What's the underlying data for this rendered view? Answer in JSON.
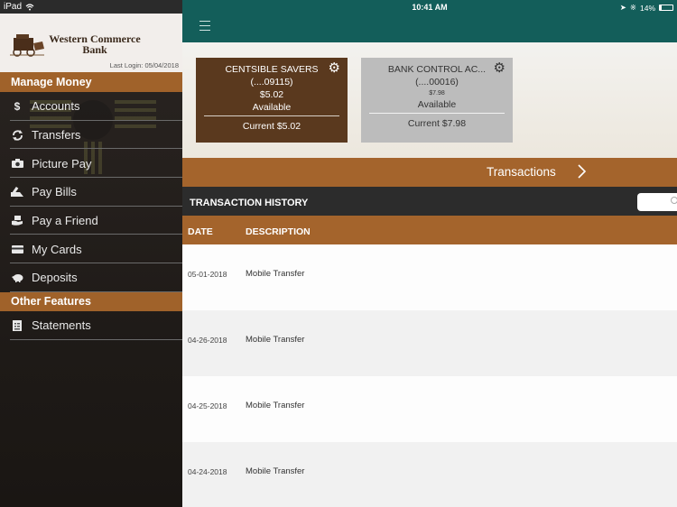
{
  "status_bar": {
    "device": "iPad",
    "time": "10:41 AM",
    "battery": "14%"
  },
  "sidebar": {
    "bank_name_line1": "Western Commerce",
    "bank_name_line2": "Bank",
    "last_login": "Last Login:  05/04/2018",
    "sections": [
      {
        "title": "Manage Money",
        "items": [
          {
            "label": "Accounts",
            "icon": "dollar-icon"
          },
          {
            "label": "Transfers",
            "icon": "refresh-icon"
          },
          {
            "label": "Picture Pay",
            "icon": "camera-icon"
          },
          {
            "label": "Pay Bills",
            "icon": "pay-bills-icon"
          },
          {
            "label": "Pay a Friend",
            "icon": "hand-money-icon"
          },
          {
            "label": "My Cards",
            "icon": "credit-card-icon"
          },
          {
            "label": "Deposits",
            "icon": "piggy-bank-icon"
          }
        ]
      },
      {
        "title": "Other Features",
        "items": [
          {
            "label": "Statements",
            "icon": "document-icon"
          }
        ]
      }
    ]
  },
  "accounts": [
    {
      "name": "CENTSIBLE SAVERS",
      "number": "(....09115)",
      "available_amount": "$5.02",
      "available_label": "Available",
      "current": "Current $5.02",
      "selected": true
    },
    {
      "name": "BANK CONTROL AC...",
      "number": "(....00016)",
      "available_amount": "$7.98",
      "available_label": "Available",
      "current": "Current $7.98",
      "selected": false
    }
  ],
  "transactions_bar": {
    "label": "Transactions"
  },
  "history": {
    "title": "TRANSACTION HISTORY",
    "search_placeholder": "",
    "columns": [
      "DATE",
      "DESCRIPTION"
    ],
    "rows": [
      {
        "date": "05-01-2018",
        "description": "Mobile Transfer"
      },
      {
        "date": "04-26-2018",
        "description": "Mobile Transfer"
      },
      {
        "date": "04-25-2018",
        "description": "Mobile Transfer"
      },
      {
        "date": "04-24-2018",
        "description": "Mobile Transfer"
      }
    ]
  },
  "colors": {
    "teal_header": "#135e5a",
    "brown_accent": "#a4642c",
    "selected_card": "#5a391e",
    "unselected_card": "#bcbcbc"
  }
}
